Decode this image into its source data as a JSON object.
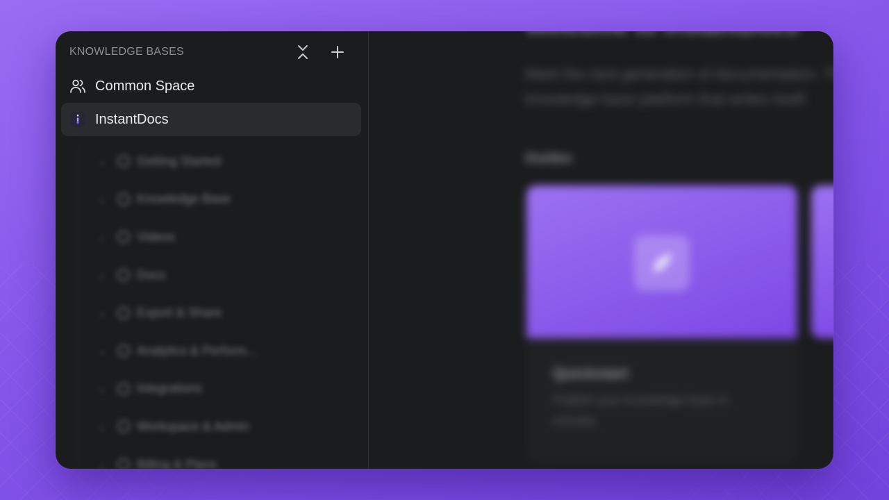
{
  "sidebar": {
    "title": "KNOWLEDGE BASES",
    "items": [
      {
        "label": "Common Space",
        "icon": "users-icon",
        "active": false
      },
      {
        "label": "InstantDocs",
        "icon": "instantdocs-logo-icon",
        "active": true
      }
    ],
    "tree": [
      "Getting Started",
      "Knowledge Base",
      "Videos",
      "Docs",
      "Export & Share",
      "Analytics & Perform...",
      "Integrations",
      "Workspace & Admin",
      "Billing & Plans"
    ]
  },
  "main": {
    "hero_title": "Welcome to InstantDocs",
    "hero_subtitle": "Meet the next generation of documentation. The first knowledge base platform that writes itself.",
    "section_title": "Guides",
    "card": {
      "title": "Quickstart",
      "description": "Publish your knowledge base in minutes"
    }
  },
  "colors": {
    "background": "#8656ea",
    "window": "#1b1c1d",
    "active_item": "#2a2b2e",
    "accent": "#8b5cf6"
  }
}
